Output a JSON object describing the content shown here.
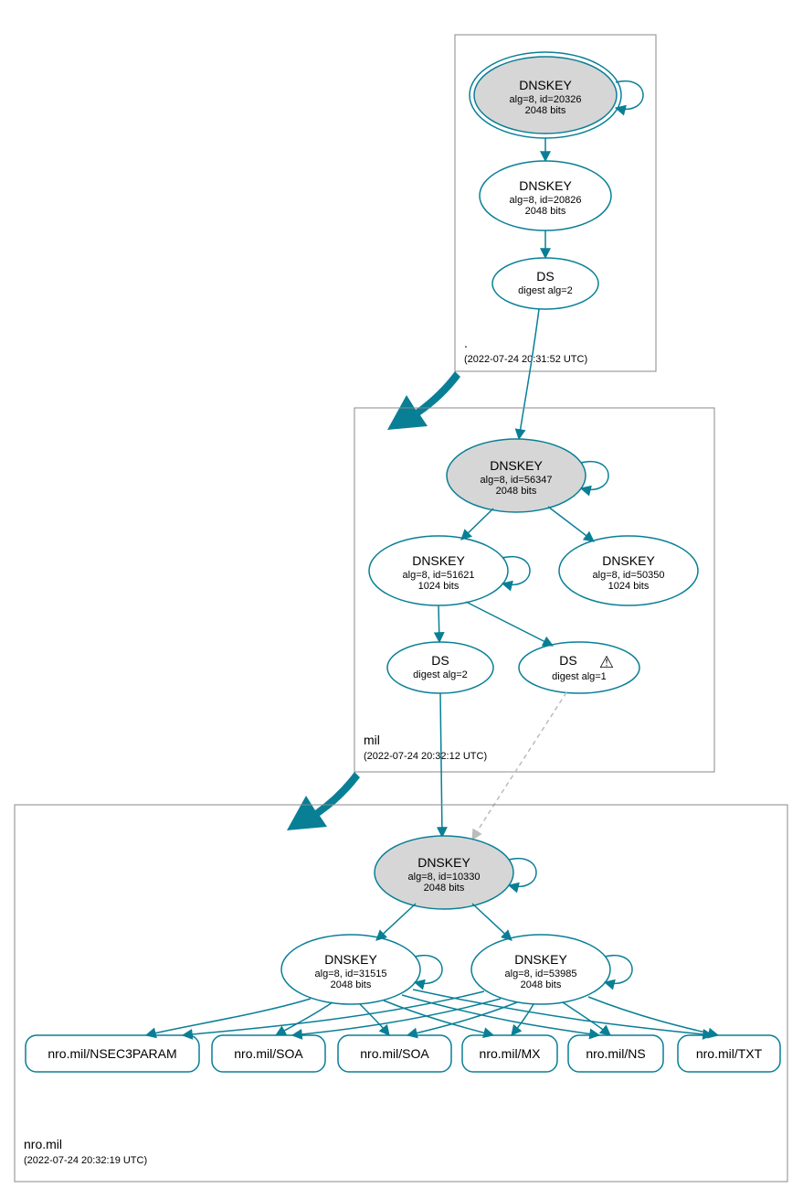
{
  "zones": {
    "root": {
      "name": ".",
      "timestamp": "(2022-07-24 20:31:52 UTC)",
      "nodes": {
        "ksk": {
          "title": "DNSKEY",
          "sub1": "alg=8, id=20326",
          "sub2": "2048 bits"
        },
        "zsk": {
          "title": "DNSKEY",
          "sub1": "alg=8, id=20826",
          "sub2": "2048 bits"
        },
        "ds": {
          "title": "DS",
          "sub1": "digest alg=2"
        }
      }
    },
    "mil": {
      "name": "mil",
      "timestamp": "(2022-07-24 20:32:12 UTC)",
      "nodes": {
        "ksk": {
          "title": "DNSKEY",
          "sub1": "alg=8, id=56347",
          "sub2": "2048 bits"
        },
        "zsk1": {
          "title": "DNSKEY",
          "sub1": "alg=8, id=51621",
          "sub2": "1024 bits"
        },
        "zsk2": {
          "title": "DNSKEY",
          "sub1": "alg=8, id=50350",
          "sub2": "1024 bits"
        },
        "ds1": {
          "title": "DS",
          "sub1": "digest alg=2"
        },
        "ds2": {
          "title": "DS",
          "sub1": "digest alg=1",
          "warn": "⚠"
        }
      }
    },
    "nro": {
      "name": "nro.mil",
      "timestamp": "(2022-07-24 20:32:19 UTC)",
      "nodes": {
        "ksk": {
          "title": "DNSKEY",
          "sub1": "alg=8, id=10330",
          "sub2": "2048 bits"
        },
        "zsk1": {
          "title": "DNSKEY",
          "sub1": "alg=8, id=31515",
          "sub2": "2048 bits"
        },
        "zsk2": {
          "title": "DNSKEY",
          "sub1": "alg=8, id=53985",
          "sub2": "2048 bits"
        }
      },
      "rrsets": {
        "r1": "nro.mil/NSEC3PARAM",
        "r2": "nro.mil/SOA",
        "r3": "nro.mil/SOA",
        "r4": "nro.mil/MX",
        "r5": "nro.mil/NS",
        "r6": "nro.mil/TXT"
      }
    }
  }
}
